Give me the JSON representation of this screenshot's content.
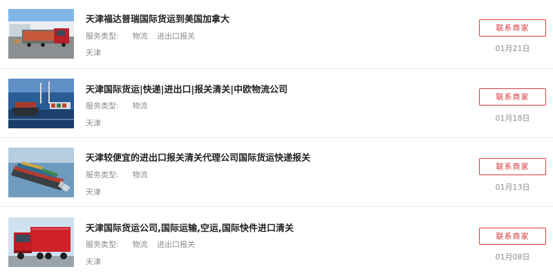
{
  "listings": [
    {
      "title": "天津福达普瑞国际货运到美国加拿大",
      "service_label": "服务类型:",
      "tags": [
        "物流",
        "进出口报关"
      ],
      "city": "天津",
      "contact_label": "联系商家",
      "date": "01月21日",
      "image_icon": "truck-warehouse-photo"
    },
    {
      "title": "天津国际货运|快递|进出口|报关清关|中欧物流公司",
      "service_label": "服务类型:",
      "tags": [
        "物流"
      ],
      "city": "天津",
      "contact_label": "联系商家",
      "date": "01月18日",
      "image_icon": "port-ship-photo"
    },
    {
      "title": "天津较便宜的进出口报关清关代理公司国际货运快递报关",
      "service_label": "服务类型:",
      "tags": [
        "物流"
      ],
      "city": "天津",
      "contact_label": "联系商家",
      "date": "01月13日",
      "image_icon": "container-ship-photo"
    },
    {
      "title": "天津国际货运公司,国际运输,空运,国际快件进口清关",
      "service_label": "服务类型:",
      "tags": [
        "物流",
        "进出口报关"
      ],
      "city": "天津",
      "contact_label": "联系商家",
      "date": "01月08日",
      "image_icon": "red-truck-photo"
    }
  ]
}
